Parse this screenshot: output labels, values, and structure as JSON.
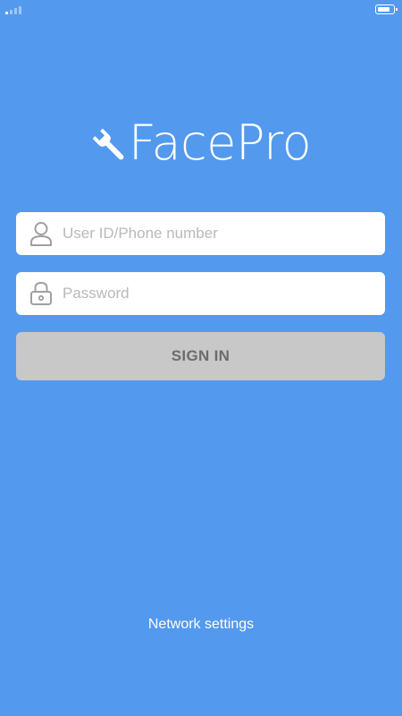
{
  "status_bar": {
    "signal_icon": "signal-strength-icon",
    "battery_icon": "battery-icon"
  },
  "brand": {
    "name": "FacePro",
    "icon": "wrench-icon",
    "color": "#ffffff"
  },
  "login": {
    "user_field": {
      "icon": "user-icon",
      "placeholder": "User ID/Phone number",
      "value": ""
    },
    "password_field": {
      "icon": "lock-icon",
      "placeholder": "Password",
      "value": ""
    },
    "sign_in_label": "SIGN IN"
  },
  "footer": {
    "network_settings_label": "Network settings"
  },
  "colors": {
    "background": "#5399ee",
    "button_disabled": "#c8c8c8",
    "button_text": "#6c6c6c",
    "placeholder": "#b9b9b9"
  }
}
